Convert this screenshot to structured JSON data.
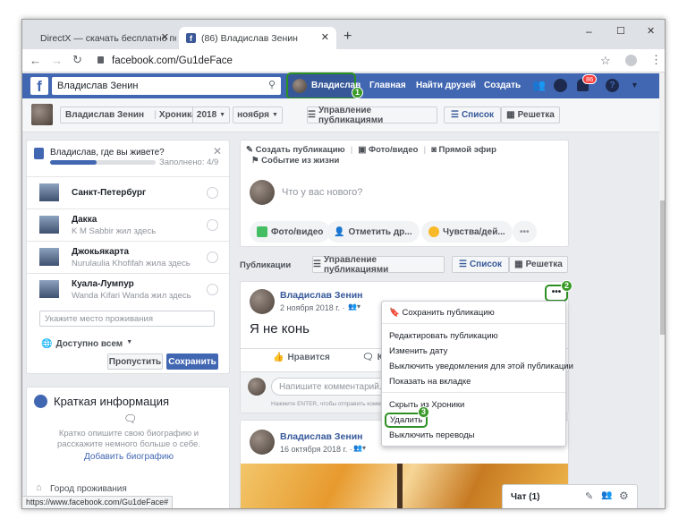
{
  "browser": {
    "tabs": [
      {
        "label": "DirectX — скачать бесплатно по"
      },
      {
        "label": "(86) Владислав Зенин"
      }
    ],
    "new_tab": "+",
    "url": "facebook.com/Gu1deFace",
    "window_controls": {
      "minimize": "–",
      "maximize": "☐",
      "close": "✕"
    },
    "status_url": "https://www.facebook.com/Gu1deFace#"
  },
  "fb_header": {
    "search_value": "Владислав Зенин",
    "profile_name": "Владислав",
    "nav": [
      "Главная",
      "Найти друзей",
      "Создать"
    ],
    "notif_count": "86"
  },
  "timeline_bar": {
    "name": "Владислав Зенин",
    "section": "Хроника",
    "year": "2018",
    "month": "ноября",
    "manage": "Управление публикациями",
    "list": "Список",
    "grid": "Решетка"
  },
  "location_card": {
    "question": "Владислав, где вы живете?",
    "progress_text": "Заполнено: 4/9",
    "progress": 0.44,
    "cities": [
      {
        "name": "Санкт-Петербург",
        "sub": ""
      },
      {
        "name": "Дакка",
        "sub": "K M Sabbir жил здесь"
      },
      {
        "name": "Джокьякарта",
        "sub": "Nurulaulia Khofifah жила здесь"
      },
      {
        "name": "Куала-Лумпур",
        "sub": "Wanda Kifari Wanda жил здесь"
      }
    ],
    "input_placeholder": "Укажите место проживания",
    "audience": "Доступно всем",
    "skip": "Пропустить",
    "save": "Сохранить"
  },
  "intro_card": {
    "title": "Краткая информация",
    "text": "Кратко опишите свою биографию и расскажите немного больше о себе.",
    "link": "Добавить биографию",
    "hometown": "Город проживания"
  },
  "composer": {
    "create": "Создать публикацию",
    "photo": "Фото/видео",
    "live": "Прямой эфир",
    "life_event": "Событие из жизни",
    "placeholder": "Что у вас нового?",
    "actions": [
      "Фото/видео",
      "Отметить др...",
      "Чувства/дей..."
    ],
    "more": "•••"
  },
  "posts_bar": {
    "title": "Публикации",
    "manage": "Управление публикациями",
    "list": "Список",
    "grid": "Решетка"
  },
  "post1": {
    "author": "Владислав Зенин",
    "date": "2 ноября 2018 г. ·",
    "text": "Я не конь",
    "like": "Нравится",
    "comment": "К",
    "comment_placeholder": "Напишите комментарий...",
    "hint": "Нажмите ENTER, чтобы отправить комм"
  },
  "post2": {
    "author": "Владислав Зенин",
    "date": "16 октября 2018 г. ·"
  },
  "menu": {
    "items": [
      "Сохранить публикацию",
      "Редактировать публикацию",
      "Изменить дату",
      "Выключить уведомления для этой публикации",
      "Показать на вкладке",
      "Скрыть из Хроники",
      "Удалить",
      "Выключить переводы"
    ]
  },
  "steps": [
    "1",
    "2",
    "3"
  ],
  "chat": {
    "label": "Чат (1)"
  }
}
